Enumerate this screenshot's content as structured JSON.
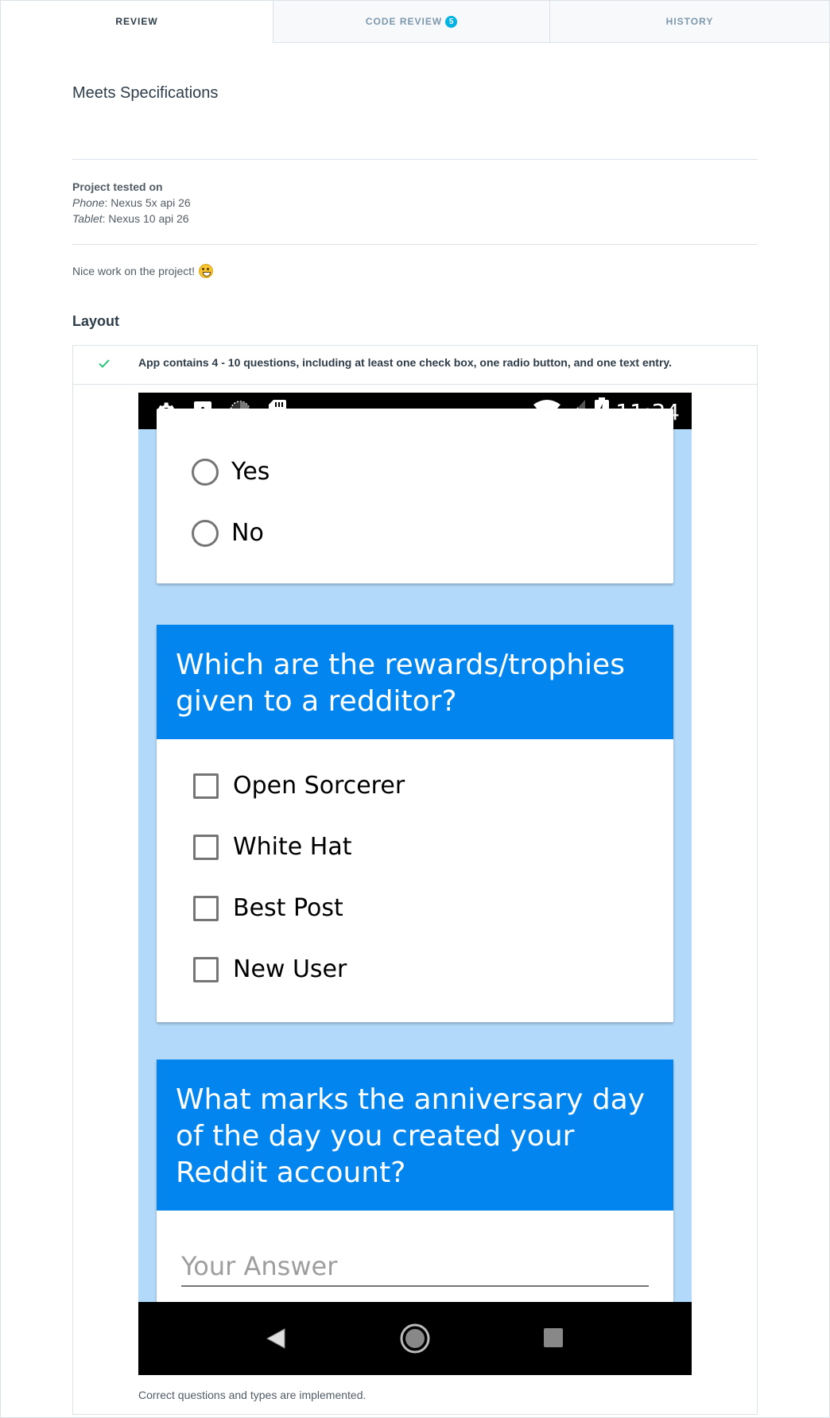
{
  "tabs": {
    "review": "REVIEW",
    "code_review": "CODE REVIEW",
    "code_review_count": "5",
    "history": "HISTORY"
  },
  "result": "Meets Specifications",
  "tested": {
    "heading": "Project tested on",
    "phone_label": "Phone",
    "phone_value": ": Nexus 5x api 26",
    "tablet_label": "Tablet",
    "tablet_value": ": Nexus 10 api 26"
  },
  "comment": "Nice work on the project!",
  "section_title": "Layout",
  "rubric": {
    "criteria": "App contains 4 - 10 questions, including at least one check box, one radio button, and one text entry.",
    "reviewer_note": "Correct questions and types are implemented."
  },
  "phone": {
    "time": "11:34",
    "radio_options": [
      "Yes",
      "No"
    ],
    "question2": "Which are the rewards/trophies given to a redditor?",
    "checkbox_options": [
      "Open Sorcerer",
      "White Hat",
      "Best Post",
      "New User"
    ],
    "question3": "What marks the anniversary day of the day you created your Reddit account?",
    "answer_placeholder": "Your Answer"
  },
  "colors": {
    "accent": "#02b3e4",
    "pass_check": "#15c26b",
    "question_header": "#0385f0",
    "app_background": "#b3d9fa"
  }
}
